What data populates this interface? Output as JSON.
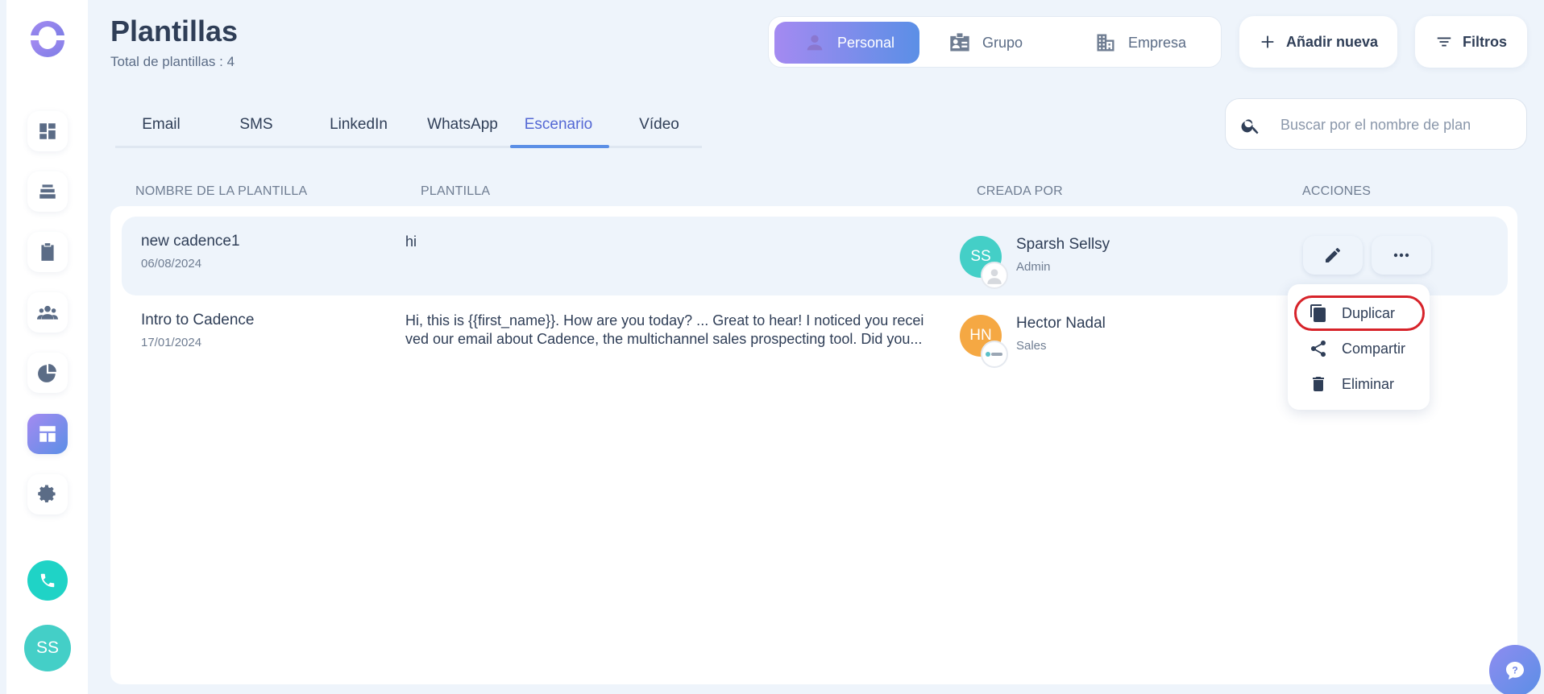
{
  "header": {
    "title": "Plantillas",
    "subtitle": "Total de plantillas : 4"
  },
  "scope_toggle": {
    "items": [
      {
        "label": "Personal",
        "icon": "person-icon",
        "active": true
      },
      {
        "label": "Grupo",
        "icon": "group-card-icon",
        "active": false
      },
      {
        "label": "Empresa",
        "icon": "building-icon",
        "active": false
      }
    ]
  },
  "actions": {
    "add_label": "Añadir nueva",
    "filters_label": "Filtros"
  },
  "tabs": [
    {
      "label": "Email"
    },
    {
      "label": "SMS"
    },
    {
      "label": "LinkedIn"
    },
    {
      "label": "WhatsApp"
    },
    {
      "label": "Escenario",
      "active": true
    },
    {
      "label": "Vídeo"
    }
  ],
  "search": {
    "placeholder": "Buscar por el nombre de plan",
    "value": ""
  },
  "table": {
    "columns": [
      "NOMBRE DE LA PLANTILLA",
      "PLANTILLA",
      "CREADA POR",
      "ACCIONES"
    ],
    "rows": [
      {
        "name": "new cadence1",
        "date": "06/08/2024",
        "body": "hi",
        "creator_initials": "SS",
        "creator_name": "Sparsh Sellsy",
        "creator_role": "Admin",
        "avatar_color": "#44cfc7"
      },
      {
        "name": "Intro to Cadence",
        "date": "17/01/2024",
        "body": "Hi, this is {{first_name}}. How are you today? ... Great to hear! I noticed you recei ved our email about Cadence, the multichannel sales prospecting tool. Did you...",
        "creator_initials": "HN",
        "creator_name": "Hector Nadal",
        "creator_role": "Sales",
        "avatar_color": "#f5a843"
      }
    ]
  },
  "row_menu": {
    "items": [
      {
        "label": "Duplicar",
        "icon": "copy-icon"
      },
      {
        "label": "Compartir",
        "icon": "share-icon"
      },
      {
        "label": "Eliminar",
        "icon": "trash-icon"
      }
    ]
  },
  "user": {
    "initials": "SS"
  },
  "colors": {
    "accent": "#5b8fe6",
    "accent_purple": "#a48af1",
    "highlight_red": "#d7232a",
    "background": "#eef4fb"
  }
}
